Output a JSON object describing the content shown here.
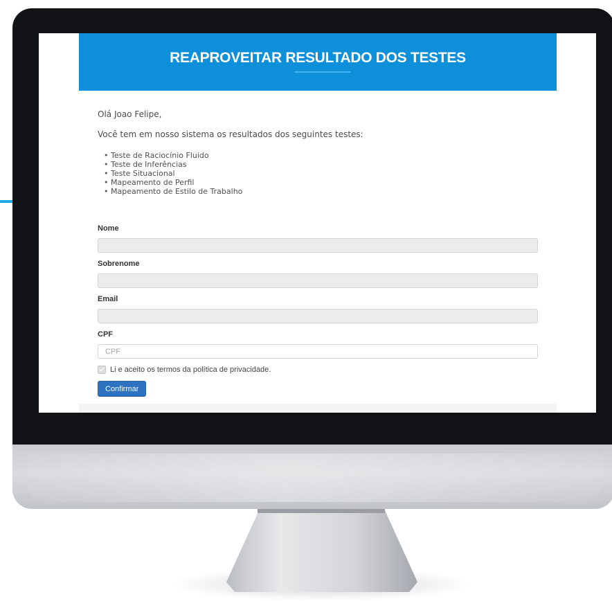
{
  "banner": {
    "title": "REAPROVEITAR RESULTADO DOS TESTES",
    "color": "#0d8fda"
  },
  "content": {
    "greeting": "Olá Joao Felipe,",
    "intro": "Você tem em nosso sistema os resultados dos seguintes testes:",
    "tests": [
      "Teste de Raciocínio Fluido",
      "Teste de Inferências",
      "Teste Situacional",
      "Mapeamento de Perfil",
      "Mapeamento de Estilo de Trabalho"
    ]
  },
  "form": {
    "name_label": "Nome",
    "name_value": "",
    "surname_label": "Sobrenome",
    "surname_value": "",
    "email_label": "Email",
    "email_value": "",
    "cpf_label": "CPF",
    "cpf_placeholder": "CPF",
    "consent_text": "Li e aceito os termos da política de privacidade.",
    "consent_checked": true,
    "confirm_label": "Confirmar",
    "confirm_color": "#2d73c2"
  }
}
